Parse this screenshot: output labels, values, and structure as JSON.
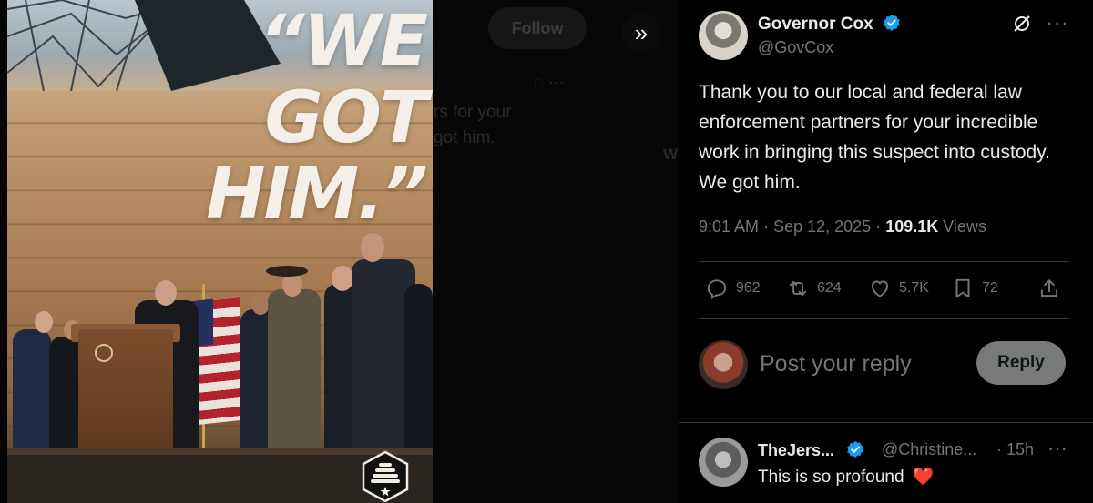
{
  "media": {
    "image_text": "“WE\nGOT\nHIM.”",
    "background": {
      "follow_label": "Follow",
      "text_line_1": "rs for your",
      "text_line_2": "got him."
    },
    "next_icon": "double-chevron-right-icon"
  },
  "tweet": {
    "author": {
      "name": "Governor Cox",
      "handle": "@GovCox",
      "verified": true
    },
    "text": "Thank you to our local and federal law enforcement partners for your incredible work in bringing this suspect into custody. We got him.",
    "time": "9:01 AM",
    "date": "Sep 12, 2025",
    "views_count": "109.1K",
    "views_label": "Views",
    "stats": {
      "replies": "962",
      "reposts": "624",
      "likes": "5.7K",
      "bookmarks": "72"
    }
  },
  "composer": {
    "placeholder": "Post your reply",
    "button_label": "Reply"
  },
  "reply": {
    "name": "TheJers...",
    "handle": "@Christine...",
    "time": "· 15h",
    "text": "This is so profound",
    "emoji": "❤️"
  },
  "colors": {
    "background": "#000000",
    "text_primary": "#e7e9ea",
    "text_secondary": "#71767b",
    "divider": "#2f3336",
    "verified": "#1d9bf0",
    "reply_button": "#787a7a"
  }
}
